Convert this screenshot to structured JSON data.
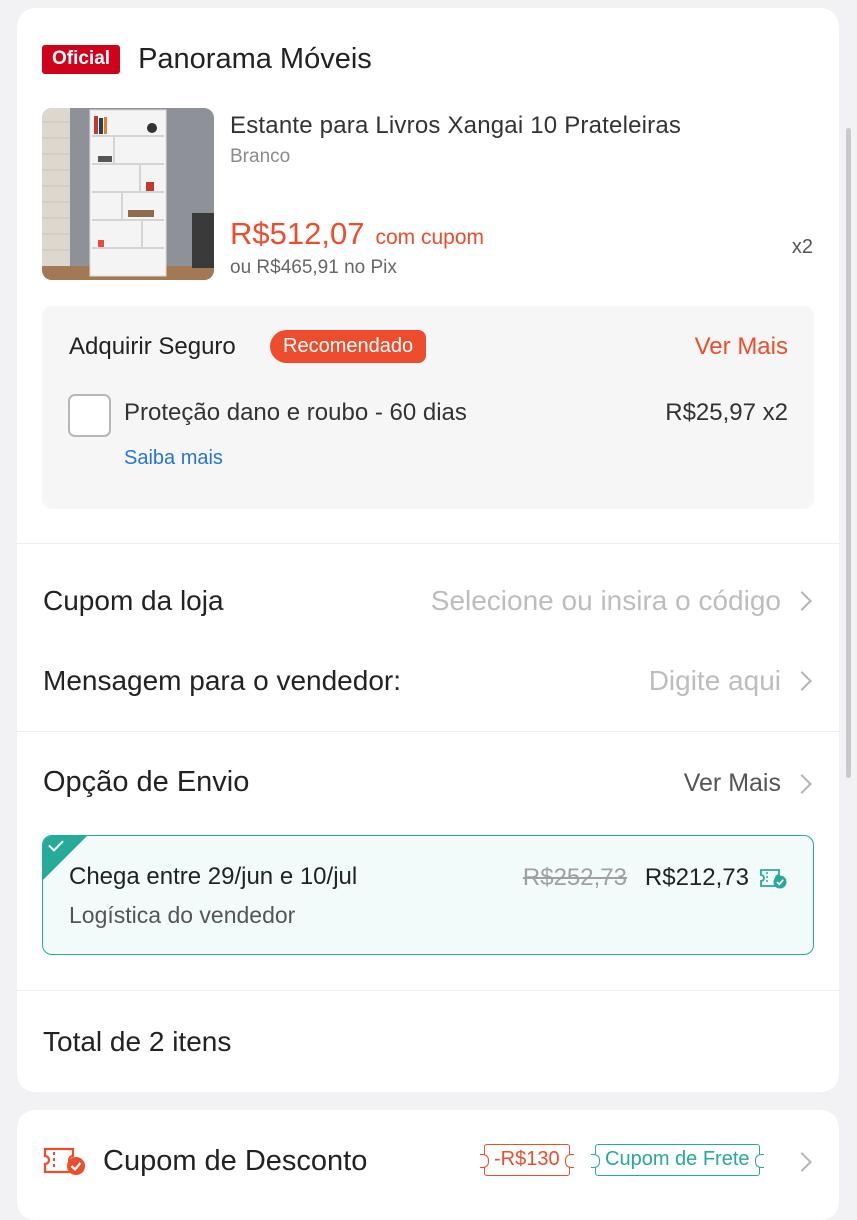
{
  "store": {
    "badge": "Oficial",
    "name": "Panorama Móveis"
  },
  "product": {
    "title": "Estante para Livros Xangai 10 Prateleiras",
    "variant": "Branco",
    "price": "R$512,07",
    "price_note": "com cupom",
    "pix_price": "ou R$465,91 no Pix",
    "quantity": "x2"
  },
  "insurance": {
    "title": "Adquirir Seguro",
    "badge": "Recomendado",
    "more": "Ver Mais",
    "option": "Proteção dano e roubo - 60 dias",
    "price": "R$25,97 x2",
    "link": "Saiba mais",
    "checked": false
  },
  "store_coupon": {
    "label": "Cupom da loja",
    "placeholder": "Selecione ou insira o código"
  },
  "message": {
    "label": "Mensagem para o vendedor:",
    "placeholder": "Digite aqui"
  },
  "shipping": {
    "title": "Opção de Envio",
    "more": "Ver Mais",
    "dates": "Chega entre 29/jun e 10/jul",
    "method": "Logística do vendedor",
    "old_price": "R$252,73",
    "price": "R$212,73",
    "selected": true
  },
  "total": "Total de 2 itens",
  "discount": {
    "label": "Cupom de Desconto",
    "tag_discount": "-R$130",
    "tag_shipping": "Cupom de Frete"
  },
  "colors": {
    "accent": "#ee4d2d",
    "teal": "#26aa99",
    "official": "#d0011b",
    "link": "#2673dd"
  },
  "icons": {
    "shipping_voucher": "voucher-check-icon",
    "coupon": "coupon-ticket-icon"
  }
}
